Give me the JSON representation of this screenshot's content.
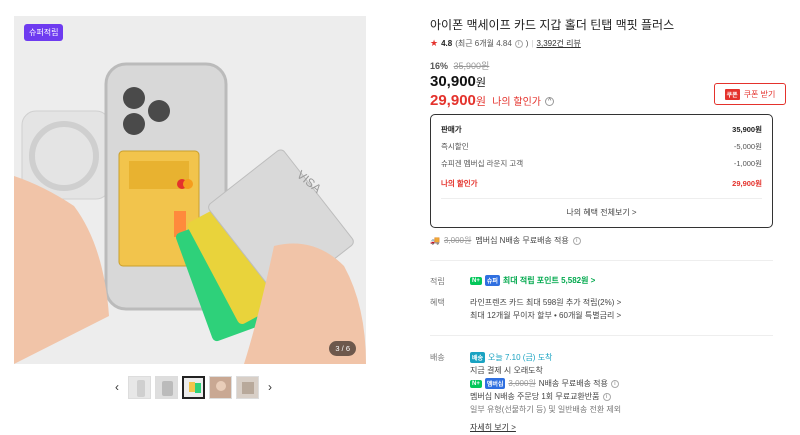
{
  "gallery": {
    "badge": "슈퍼적립",
    "counter": "3 / 6",
    "thumbnails": [
      "thumb-1",
      "thumb-2",
      "thumb-3",
      "thumb-4",
      "thumb-5"
    ],
    "active_thumb": 3
  },
  "product": {
    "title": "아이폰 맥세이프 카드 지갑 홀더 틴탭 맥핏 플러스",
    "rating": "4.8",
    "rating_recent": "(최근 6개월 4.84",
    "reviews": "3,392건 리뷰",
    "discount_rate": "16%",
    "original_price": "35,900원",
    "price": "30,900",
    "price_unit": "원",
    "my_price": "29,900",
    "my_price_unit": "원",
    "my_price_label": "나의 할인가",
    "coupon_label": "쿠폰 받기",
    "coupon_icon_label": "쿠폰"
  },
  "pricebox": {
    "rows": [
      {
        "label": "판매가",
        "value": "35,900원"
      },
      {
        "label": "즉시할인",
        "value": "-5,000원"
      },
      {
        "label": "슈피겐 멤버십 라운지 고객",
        "value": "-1,000원"
      },
      {
        "label": "나의 할인가",
        "value": "29,900원"
      }
    ],
    "link": "나의 혜택 전체보기 >"
  },
  "shipping_top": {
    "strike": "3,000원",
    "text": "멤버십 N배송 무료배송 적용"
  },
  "points": {
    "label": "적립",
    "tag_n": "N+",
    "tag_2": "슈퍼",
    "text": "최대 적립 포인트 5,582원 >"
  },
  "benefits": {
    "label": "혜택",
    "line1": "라인프렌즈 카드 최대 598원 추가 적립(2%) >",
    "line2": "최대 12개월 무이자 할부 • 60개월 특별금리 >"
  },
  "delivery": {
    "label": "배송",
    "tag": "배송",
    "date": "오늘 7.10 (금) 도착",
    "line1": "지금 결제 시 오래도착",
    "tag_n": "N+",
    "tag_member": "멤버십",
    "strike": "3,000원",
    "line2_text": "N배송 무료배송 적용",
    "line3": "멤버십 N배송 주문당 1회 무료교환반품",
    "line4": "일부 유형(선물하기 등) 및 일반배송 전환 제외",
    "more": "자세히 보기 >"
  }
}
